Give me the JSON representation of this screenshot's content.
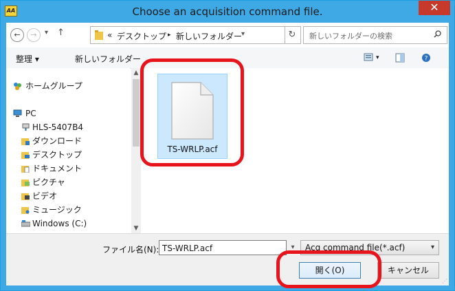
{
  "window": {
    "title": "Choose an acquisition command file.",
    "close_glyph": "✕"
  },
  "address": {
    "crumbs": [
      "«",
      "デスクトップ",
      "▸",
      "新しいフォルダー"
    ],
    "search_placeholder": "新しいフォルダーの検索"
  },
  "toolbar": {
    "organize_label": "整理 ▾",
    "new_folder_label": "新しいフォルダー"
  },
  "nav": {
    "items": [
      {
        "label": "ホームグループ",
        "icon": "homegroup-icon"
      },
      {
        "label": "PC",
        "icon": "pc-icon"
      },
      {
        "label": "HLS-5407B4",
        "icon": "network-drive-icon"
      },
      {
        "label": "ダウンロード",
        "icon": "downloads-folder-icon"
      },
      {
        "label": "デスクトップ",
        "icon": "desktop-folder-icon"
      },
      {
        "label": "ドキュメント",
        "icon": "documents-folder-icon"
      },
      {
        "label": "ピクチャ",
        "icon": "pictures-folder-icon"
      },
      {
        "label": "ビデオ",
        "icon": "videos-folder-icon"
      },
      {
        "label": "ミュージック",
        "icon": "music-folder-icon"
      },
      {
        "label": "Windows (C:)",
        "icon": "drive-icon"
      }
    ]
  },
  "files": [
    {
      "name": "TS-WRLP.acf",
      "icon": "document-file-icon",
      "selected": true
    }
  ],
  "bottom": {
    "filename_label": "ファイル名(N):",
    "filename_value": "TS-WRLP.acf",
    "filter_value": "Acq command file(*.acf)",
    "open_label": "開く(O)",
    "cancel_label": "キャンセル"
  },
  "colors": {
    "titlebar": "#3fa9e6",
    "close": "#c7392b",
    "selection": "#cce8ff",
    "annotation": "#e8141c"
  }
}
